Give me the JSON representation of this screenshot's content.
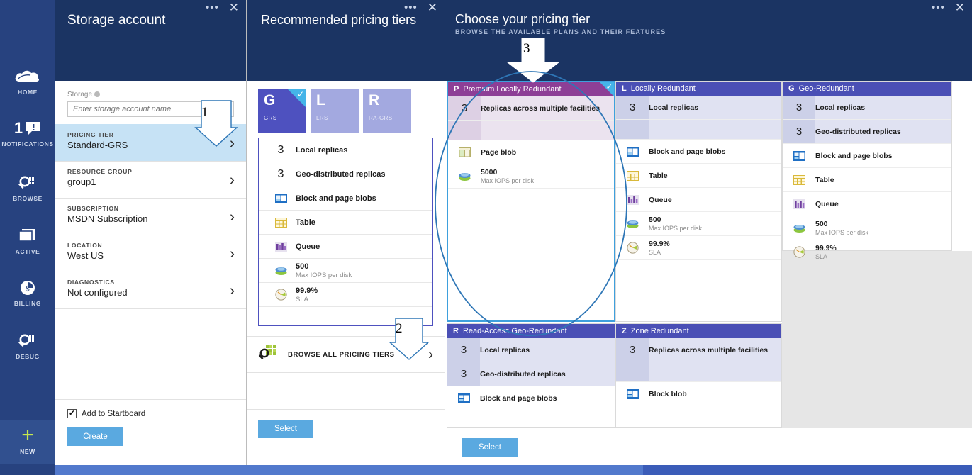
{
  "rail": {
    "items": [
      {
        "label": "HOME",
        "icon": "cloud-icon"
      },
      {
        "label": "NOTIFICATIONS",
        "icon": "notification-icon",
        "badge": "1"
      },
      {
        "label": "BROWSE",
        "icon": "browse-search-icon"
      },
      {
        "label": "ACTIVE",
        "icon": "active-window-icon"
      },
      {
        "label": "BILLING",
        "icon": "billing-dollar-icon"
      },
      {
        "label": "DEBUG",
        "icon": "debug-search-icon"
      }
    ],
    "new": {
      "label": "NEW",
      "icon": "plus-icon",
      "glyph": "+"
    }
  },
  "blade1": {
    "title": "Storage account",
    "field": {
      "label": "Storage",
      "placeholder": "Enter storage account name",
      "value": ""
    },
    "rows": [
      {
        "caption": "PRICING TIER",
        "value": "Standard-GRS",
        "selected": true
      },
      {
        "caption": "RESOURCE GROUP",
        "value": "group1",
        "selected": false
      },
      {
        "caption": "SUBSCRIPTION",
        "value": "MSDN Subscription",
        "selected": false
      },
      {
        "caption": "LOCATION",
        "value": "West US",
        "selected": false
      },
      {
        "caption": "DIAGNOSTICS",
        "value": "Not configured",
        "selected": false
      }
    ],
    "startboard": {
      "label": "Add to Startboard",
      "checked": true,
      "glyph": "✔"
    },
    "create_label": "Create"
  },
  "blade2": {
    "title": "Recommended pricing tiers",
    "tiles": [
      {
        "letter": "G",
        "sub": "GRS",
        "active": true,
        "check": "✓"
      },
      {
        "letter": "L",
        "sub": "LRS",
        "active": false
      },
      {
        "letter": "R",
        "sub": "RA-GRS",
        "active": false
      }
    ],
    "features": [
      {
        "num": "3",
        "text": "Local replicas",
        "sub": ""
      },
      {
        "num": "3",
        "text": "Geo-distributed replicas",
        "sub": ""
      },
      {
        "icon": "blob-icon",
        "text": "Block and page blobs",
        "sub": ""
      },
      {
        "icon": "table-icon",
        "text": "Table",
        "sub": ""
      },
      {
        "icon": "queue-icon",
        "text": "Queue",
        "sub": ""
      },
      {
        "icon": "disk-icon",
        "text": "500",
        "sub": "Max IOPS per disk"
      },
      {
        "icon": "sla-gauge-icon",
        "text": "99.9%",
        "sub": "SLA"
      }
    ],
    "browse_all": {
      "label": "BROWSE ALL PRICING TIERS",
      "icon": "browse-grid-search-icon",
      "chevron": "›"
    },
    "select_label": "Select"
  },
  "blade3": {
    "title": "Choose your pricing tier",
    "subtitle": "BROWSE THE AVAILABLE PLANS AND THEIR FEATURES",
    "select_label": "Select",
    "cards": [
      {
        "letter": "P",
        "name": "Premium Locally Redundant",
        "header_color": "#8d3f96",
        "selected": true,
        "check": "✓",
        "rows": [
          {
            "type": "num",
            "num": "3",
            "text": "Replicas across multiple facilities",
            "sub": "",
            "shade": "a"
          },
          {
            "type": "blank",
            "shade": "a"
          },
          {
            "type": "icon",
            "icon": "page-blob-icon",
            "text": "Page blob",
            "sub": ""
          },
          {
            "type": "icon",
            "icon": "disk-icon",
            "text": "5000",
            "sub": "Max IOPS per disk"
          }
        ]
      },
      {
        "letter": "L",
        "name": "Locally Redundant",
        "header_color": "#4a4fb5",
        "selected": false,
        "rows": [
          {
            "type": "num",
            "num": "3",
            "text": "Local replicas",
            "sub": "",
            "shade": "b"
          },
          {
            "type": "blank",
            "shade": "b"
          },
          {
            "type": "icon",
            "icon": "blob-icon",
            "text": "Block and page blobs",
            "sub": ""
          },
          {
            "type": "icon",
            "icon": "table-icon",
            "text": "Table",
            "sub": ""
          },
          {
            "type": "icon",
            "icon": "queue-icon",
            "text": "Queue",
            "sub": ""
          },
          {
            "type": "icon",
            "icon": "disk-icon",
            "text": "500",
            "sub": "Max IOPS per disk"
          },
          {
            "type": "icon",
            "icon": "sla-gauge-icon",
            "text": "99.9%",
            "sub": "SLA"
          }
        ]
      },
      {
        "letter": "G",
        "name": "Geo-Redundant",
        "header_color": "#4a4fb5",
        "selected": false,
        "rows": [
          {
            "type": "num",
            "num": "3",
            "text": "Local replicas",
            "sub": "",
            "shade": "b"
          },
          {
            "type": "num",
            "num": "3",
            "text": "Geo-distributed replicas",
            "sub": "",
            "shade": "b"
          },
          {
            "type": "icon",
            "icon": "blob-icon",
            "text": "Block and page blobs",
            "sub": ""
          },
          {
            "type": "icon",
            "icon": "table-icon",
            "text": "Table",
            "sub": ""
          },
          {
            "type": "icon",
            "icon": "queue-icon",
            "text": "Queue",
            "sub": ""
          },
          {
            "type": "icon",
            "icon": "disk-icon",
            "text": "500",
            "sub": "Max IOPS per disk"
          },
          {
            "type": "icon",
            "icon": "sla-gauge-icon",
            "text": "99.9%",
            "sub": "SLA"
          }
        ]
      },
      {
        "letter": "R",
        "name": "Read-Access Geo-Redundant",
        "header_color": "#4a4fb5",
        "selected": false,
        "rows": [
          {
            "type": "num",
            "num": "3",
            "text": "Local replicas",
            "sub": "",
            "shade": "b"
          },
          {
            "type": "num",
            "num": "3",
            "text": "Geo-distributed replicas",
            "sub": "",
            "shade": "b"
          },
          {
            "type": "icon",
            "icon": "blob-icon",
            "text": "Block and page blobs",
            "sub": ""
          }
        ]
      },
      {
        "letter": "Z",
        "name": "Zone Redundant",
        "header_color": "#4a4fb5",
        "selected": false,
        "rows": [
          {
            "type": "num",
            "num": "3",
            "text": "Replicas across multiple facilities",
            "sub": "",
            "shade": "b"
          },
          {
            "type": "blank",
            "shade": "b"
          },
          {
            "type": "icon",
            "icon": "blob-icon",
            "text": "Block blob",
            "sub": ""
          }
        ]
      }
    ]
  },
  "window_controls": {
    "dots": "•••",
    "close": "✕"
  },
  "annotations": [
    {
      "label": "1"
    },
    {
      "label": "2"
    },
    {
      "label": "3"
    }
  ],
  "colors": {
    "nav": "#27427f",
    "blade_header": "#1b3463",
    "accent_button": "#5aa9e0",
    "selected_row": "#c6e2f5",
    "premium_header": "#8d3f96",
    "standard_header": "#4a4fb5",
    "tile_active": "#4e51bf",
    "tile_idle": "#a3a9e0",
    "check_corner": "#45b4e8",
    "annotation": "#2e76b6"
  }
}
